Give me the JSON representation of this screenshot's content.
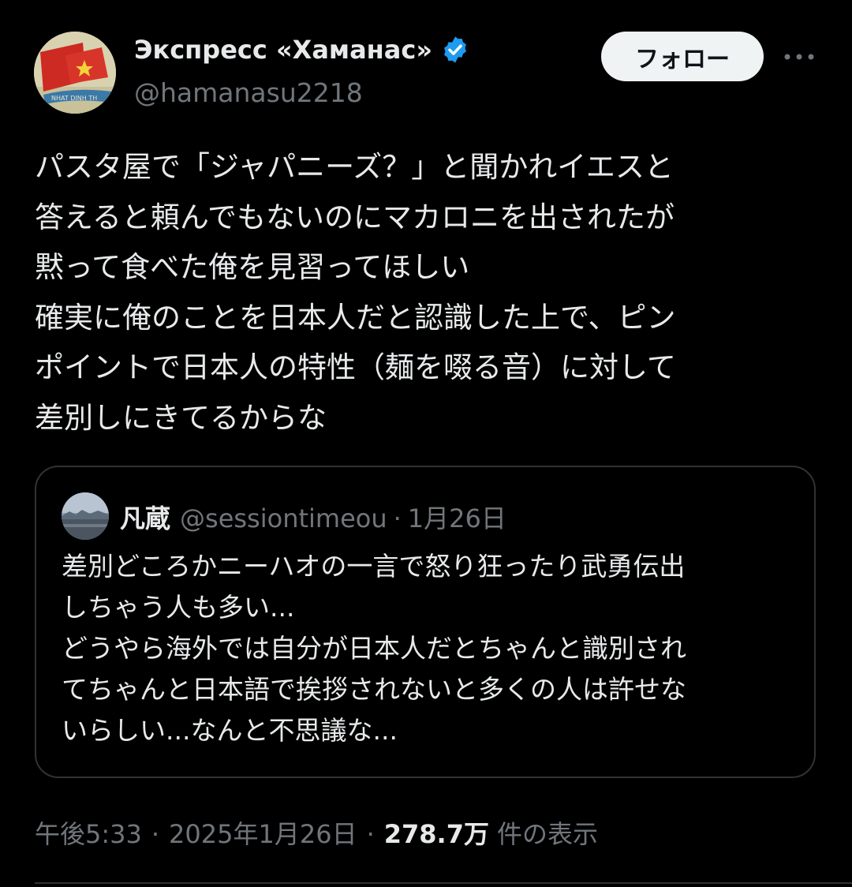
{
  "author": {
    "display_name": "Экспресс «Хаманас»",
    "handle": "@hamanasu2218",
    "verified_icon": "verified-badge-icon",
    "avatar_banner_text": "NHAT DINH TH"
  },
  "actions": {
    "follow_label": "フォロー",
    "more_icon": "more-options-icon"
  },
  "tweet": {
    "lines": [
      "パスタ屋で「ジャパニーズ？」と聞かれイエスと",
      "答えると頼んでもないのにマカロニを出されたが",
      "黙って食べた俺を見習ってほしい",
      "確実に俺のことを日本人だと認識した上で、ピン",
      "ポイントで日本人の特性（麺を啜る音）に対して",
      "差別しにきてるからな"
    ]
  },
  "quote": {
    "name": "凡蔵",
    "handle": "@sessiontimeou",
    "separator": "·",
    "date": "1月26日",
    "lines": [
      "差別どころかニーハオの一言で怒り狂ったり武勇伝出",
      "しちゃう人も多い...",
      "どうやら海外では自分が日本人だとちゃんと識別され",
      "てちゃんと日本語で挨拶されないと多くの人は許せな",
      "いらしい...なんと不思議な..."
    ]
  },
  "meta": {
    "time": "午後5:33",
    "separator": "·",
    "date": "2025年1月26日",
    "views_count": "278.7万",
    "views_label": "件の表示"
  },
  "colors": {
    "background": "#000000",
    "text_primary": "#e7e9ea",
    "text_secondary": "#71767b",
    "border": "#2f3336",
    "verified_blue": "#1d9bf0",
    "follow_bg": "#eff3f4"
  }
}
